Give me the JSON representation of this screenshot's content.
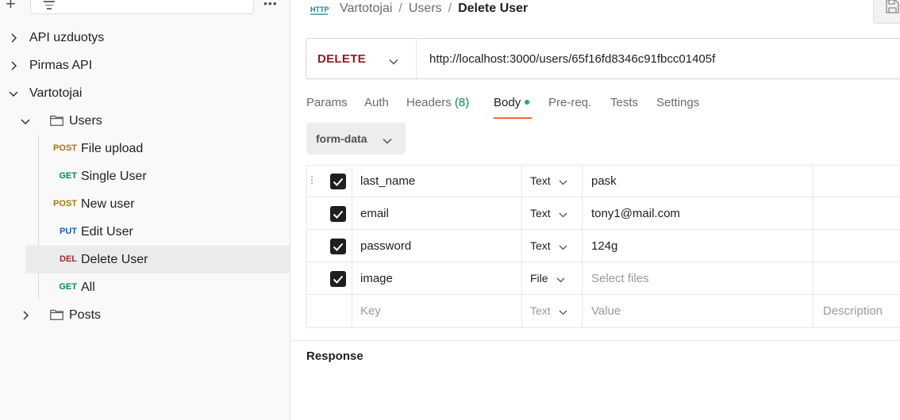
{
  "sidebar": {
    "items": [
      {
        "label": "API uzduotys"
      },
      {
        "label": "Pirmas API"
      },
      {
        "label": "Vartotojai"
      },
      {
        "label": "Users"
      },
      {
        "method": "POST",
        "label": "File upload",
        "method_color": "#a8770b"
      },
      {
        "method": "GET",
        "label": "Single User",
        "method_color": "#0b8a4a"
      },
      {
        "method": "POST",
        "label": "New user",
        "method_color": "#a8770b"
      },
      {
        "method": "PUT",
        "label": "Edit User",
        "method_color": "#1a5fb4"
      },
      {
        "method": "DEL",
        "label": "Delete User",
        "method_color": "#a32a2a"
      },
      {
        "method": "GET",
        "label": "All",
        "method_color": "#0b8a4a"
      },
      {
        "label": "Posts"
      }
    ],
    "selected": "Delete User"
  },
  "header": {
    "icon": "http-icon",
    "breadcrumb": [
      "Vartotojai",
      "Users"
    ],
    "current": "Delete User",
    "separator": "/"
  },
  "request": {
    "method": "DELETE",
    "method_color": "#8f1d1d",
    "url": "http://localhost:3000/users/65f16fd8346c91fbcc01405f"
  },
  "tabs": {
    "params": "Params",
    "auth": "Auth",
    "headers": "Headers",
    "headers_count": "(8)",
    "body": "Body",
    "prereq": "Pre-req.",
    "tests": "Tests",
    "settings": "Settings",
    "active": "Body",
    "accent": "#f26b3a"
  },
  "body_type": "form-data",
  "form_rows": [
    {
      "checked": true,
      "key": "last_name",
      "type": "Text",
      "value": "pask"
    },
    {
      "checked": true,
      "key": "email",
      "type": "Text",
      "value": "tony1@mail.com"
    },
    {
      "checked": true,
      "key": "password",
      "type": "Text",
      "value": "124g"
    },
    {
      "checked": true,
      "key": "image",
      "type": "File",
      "value": "Select files"
    }
  ],
  "new_row": {
    "key_placeholder": "Key",
    "type": "Text",
    "value_placeholder": "Value",
    "description_placeholder": "Description"
  },
  "response": {
    "title": "Response"
  }
}
